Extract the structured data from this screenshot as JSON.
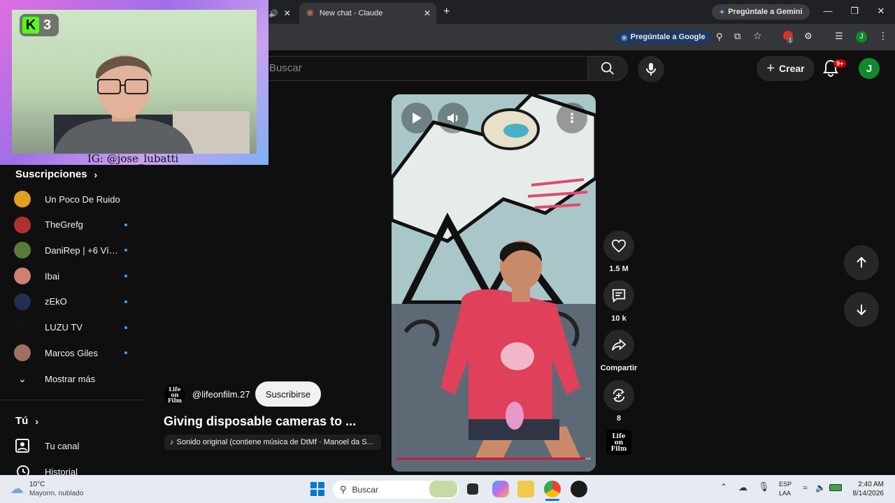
{
  "browser": {
    "tabs": [
      {
        "label": "New chat - Claude"
      }
    ],
    "gemini_button": "Pregúntale a Gemini",
    "google_ask_button": "Pregúntale a Google",
    "profile_initial": "J",
    "extension_badge": "1"
  },
  "webcam": {
    "handle": "IG: @jose_lubatti",
    "kick_logo": "K",
    "kick_count": "3"
  },
  "header": {
    "search_placeholder": "Buscar",
    "create_label": "Crear",
    "notifications_badge": "9+",
    "avatar_initial": "J"
  },
  "sidebar": {
    "subscriptions_title": "Suscripciones",
    "subscriptions": [
      {
        "name": "Un Poco De Ruido",
        "color": "#e0a020",
        "new": false
      },
      {
        "name": "TheGrefg",
        "color": "#b03030",
        "new": true
      },
      {
        "name": "DaniRep | +6 Vídeos Diarios De Fútbol",
        "color": "#5a7a3a",
        "new": true
      },
      {
        "name": "Ibai",
        "color": "#d08070",
        "new": true
      },
      {
        "name": "zEkO",
        "color": "#203050",
        "new": true
      },
      {
        "name": "LUZU TV",
        "color": "#111111",
        "new": true
      },
      {
        "name": "Marcos Giles",
        "color": "#a07060",
        "new": true
      }
    ],
    "show_more": "Mostrar más",
    "you_title": "Tú",
    "your_channel": "Tu canal",
    "history": "Historial"
  },
  "short": {
    "channel_handle": "@lifeonfilm.27",
    "channel_logo_text": "Life on Film",
    "subscribe_label": "Suscribirse",
    "title": "Giving disposable cameras to ...",
    "sound": "Sonido original (contiene música de DtMf · Manoel da S...",
    "progress": 0.97,
    "likes": "1.5 M",
    "comments": "10 k",
    "share_label": "Compartir",
    "remix_count": "8"
  },
  "taskbar": {
    "weather_temp": "10°C",
    "weather_desc": "Mayorm. nublado",
    "search_placeholder": "Buscar",
    "language_line1": "ESP",
    "language_line2": "LAA",
    "time": "2:40 AM",
    "date": "8/14/2026"
  }
}
